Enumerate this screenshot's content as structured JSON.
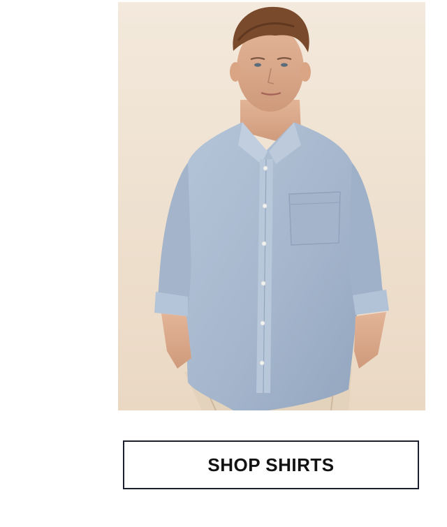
{
  "hero": {
    "image": "model-in-blue-oxford-shirt"
  },
  "cta": {
    "label": "SHOP SHIRTS"
  },
  "colors": {
    "background": "#ffffff",
    "hero_backdrop": "#f0e2d2",
    "shirt": "#a8b9cf",
    "button_border": "#1b1f2e",
    "button_text": "#121212"
  }
}
